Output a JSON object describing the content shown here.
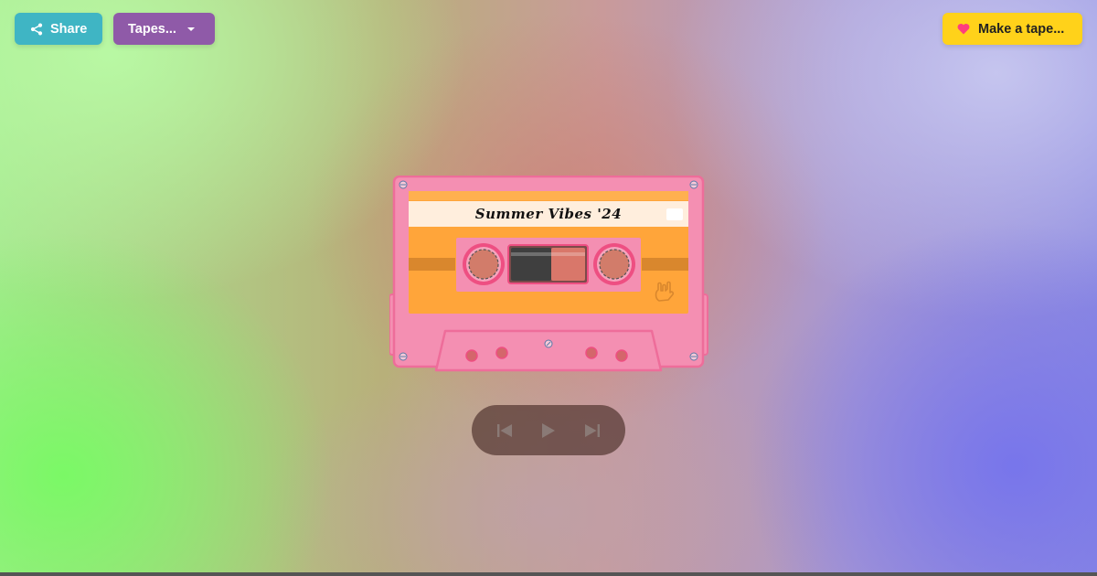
{
  "toolbar": {
    "share_label": "Share",
    "tapes_label": "Tapes...",
    "make_tape_label": "Make a tape..."
  },
  "icons": {
    "share": "share-icon",
    "tapes_dropdown": "chevron-down-icon",
    "make_tape": "heart-icon",
    "previous": "skip-previous-icon",
    "play": "play-icon",
    "next": "skip-next-icon",
    "cassette_sticker": "rock-hand-icon"
  },
  "cassette": {
    "title": "Summer Vibes '24",
    "colors": {
      "shell": "#f48fb2",
      "shell_border": "#ee6d9a",
      "label": "#ffa53a",
      "title_strip": "#ffeedd"
    }
  },
  "colors": {
    "share_button": "#3fb5c4",
    "tapes_button": "#8f5aa8",
    "make_tape_button": "#ffd21a",
    "heart": "#ff3d7f",
    "player_controls": "#8a7a76"
  }
}
